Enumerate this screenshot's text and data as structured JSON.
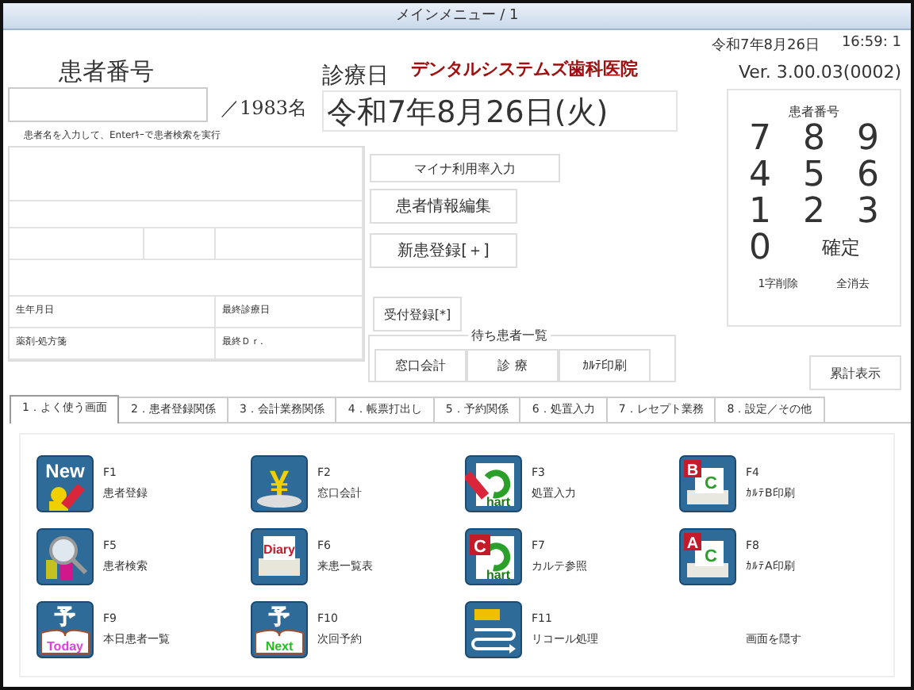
{
  "window": {
    "title": "メインメニュー / 1"
  },
  "header": {
    "date": "令和7年8月26日",
    "time": "16:59: 1",
    "version": "Ver. 3.00.03(0002)",
    "clinic_name": "デンタルシステムズ歯科医院"
  },
  "patient": {
    "label": "患者番号",
    "count": "／1983名",
    "hint": "患者名を入力して、Enterｷｰで患者検索を実行",
    "info_labels": [
      "生年月日",
      "最終診療日",
      "薬剤-処方箋",
      "最終Ｄｒ."
    ]
  },
  "visit_date": {
    "label": "診療日",
    "value": "令和7年8月26日(火)"
  },
  "buttons": [
    "マイナ利用率入力",
    "患者情報編集",
    "新患登録[＋]"
  ],
  "reception_button": "受付登録[*]",
  "waiting": {
    "title": "待ち患者一覧",
    "buttons": [
      "窓口会計",
      "診 療",
      "ｶﾙﾃ印刷"
    ]
  },
  "keypad": {
    "title": "患者番号",
    "keys": [
      "7",
      "8",
      "9",
      "4",
      "5",
      "6",
      "1",
      "2",
      "3",
      "0"
    ],
    "confirm": "確定",
    "delete_one": "1字削除",
    "clear_all": "全消去"
  },
  "total_button": "累計表示",
  "tabs": [
    {
      "label": "1．よく使う画面",
      "selected": true
    },
    {
      "label": "2．患者登録関係",
      "selected": false
    },
    {
      "label": "3．会計業務関係",
      "selected": false
    },
    {
      "label": "4．帳票打出し",
      "selected": false
    },
    {
      "label": "5．予約関係",
      "selected": false
    },
    {
      "label": "6．処置入力",
      "selected": false
    },
    {
      "label": "7．レセプト業務",
      "selected": false
    },
    {
      "label": "8．設定／その他",
      "selected": false
    }
  ],
  "functions": [
    {
      "key": "F1",
      "label": "患者登録",
      "kind": "new",
      "icon_text": [
        "New"
      ]
    },
    {
      "key": "F2",
      "label": "窓口会計",
      "kind": "yen",
      "icon_text": [
        "¥"
      ]
    },
    {
      "key": "F3",
      "label": "処置入力",
      "kind": "chart",
      "icon_text": [
        "hart"
      ]
    },
    {
      "key": "F4",
      "label": "ｶﾙﾃB印刷",
      "kind": "print",
      "icon_text": [
        "B",
        "C"
      ]
    },
    {
      "key": "F5",
      "label": "患者検索",
      "kind": "search"
    },
    {
      "key": "F6",
      "label": "来患一覧表",
      "kind": "diary",
      "icon_text": [
        "Diary"
      ]
    },
    {
      "key": "F7",
      "label": "カルテ参照",
      "kind": "chart",
      "icon_text": [
        "C",
        "hart"
      ]
    },
    {
      "key": "F8",
      "label": "ｶﾙﾃA印刷",
      "kind": "print",
      "icon_text": [
        "A",
        "C"
      ]
    },
    {
      "key": "F9",
      "label": "本日患者一覧",
      "kind": "book",
      "icon_text": [
        "予",
        "Today"
      ]
    },
    {
      "key": "F10",
      "label": "次回予約",
      "kind": "book",
      "icon_text": [
        "予",
        "Next"
      ]
    },
    {
      "key": "F11",
      "label": "リコール処理",
      "kind": "recall"
    },
    {
      "label": "画面を隠す",
      "kind": "plain"
    }
  ]
}
